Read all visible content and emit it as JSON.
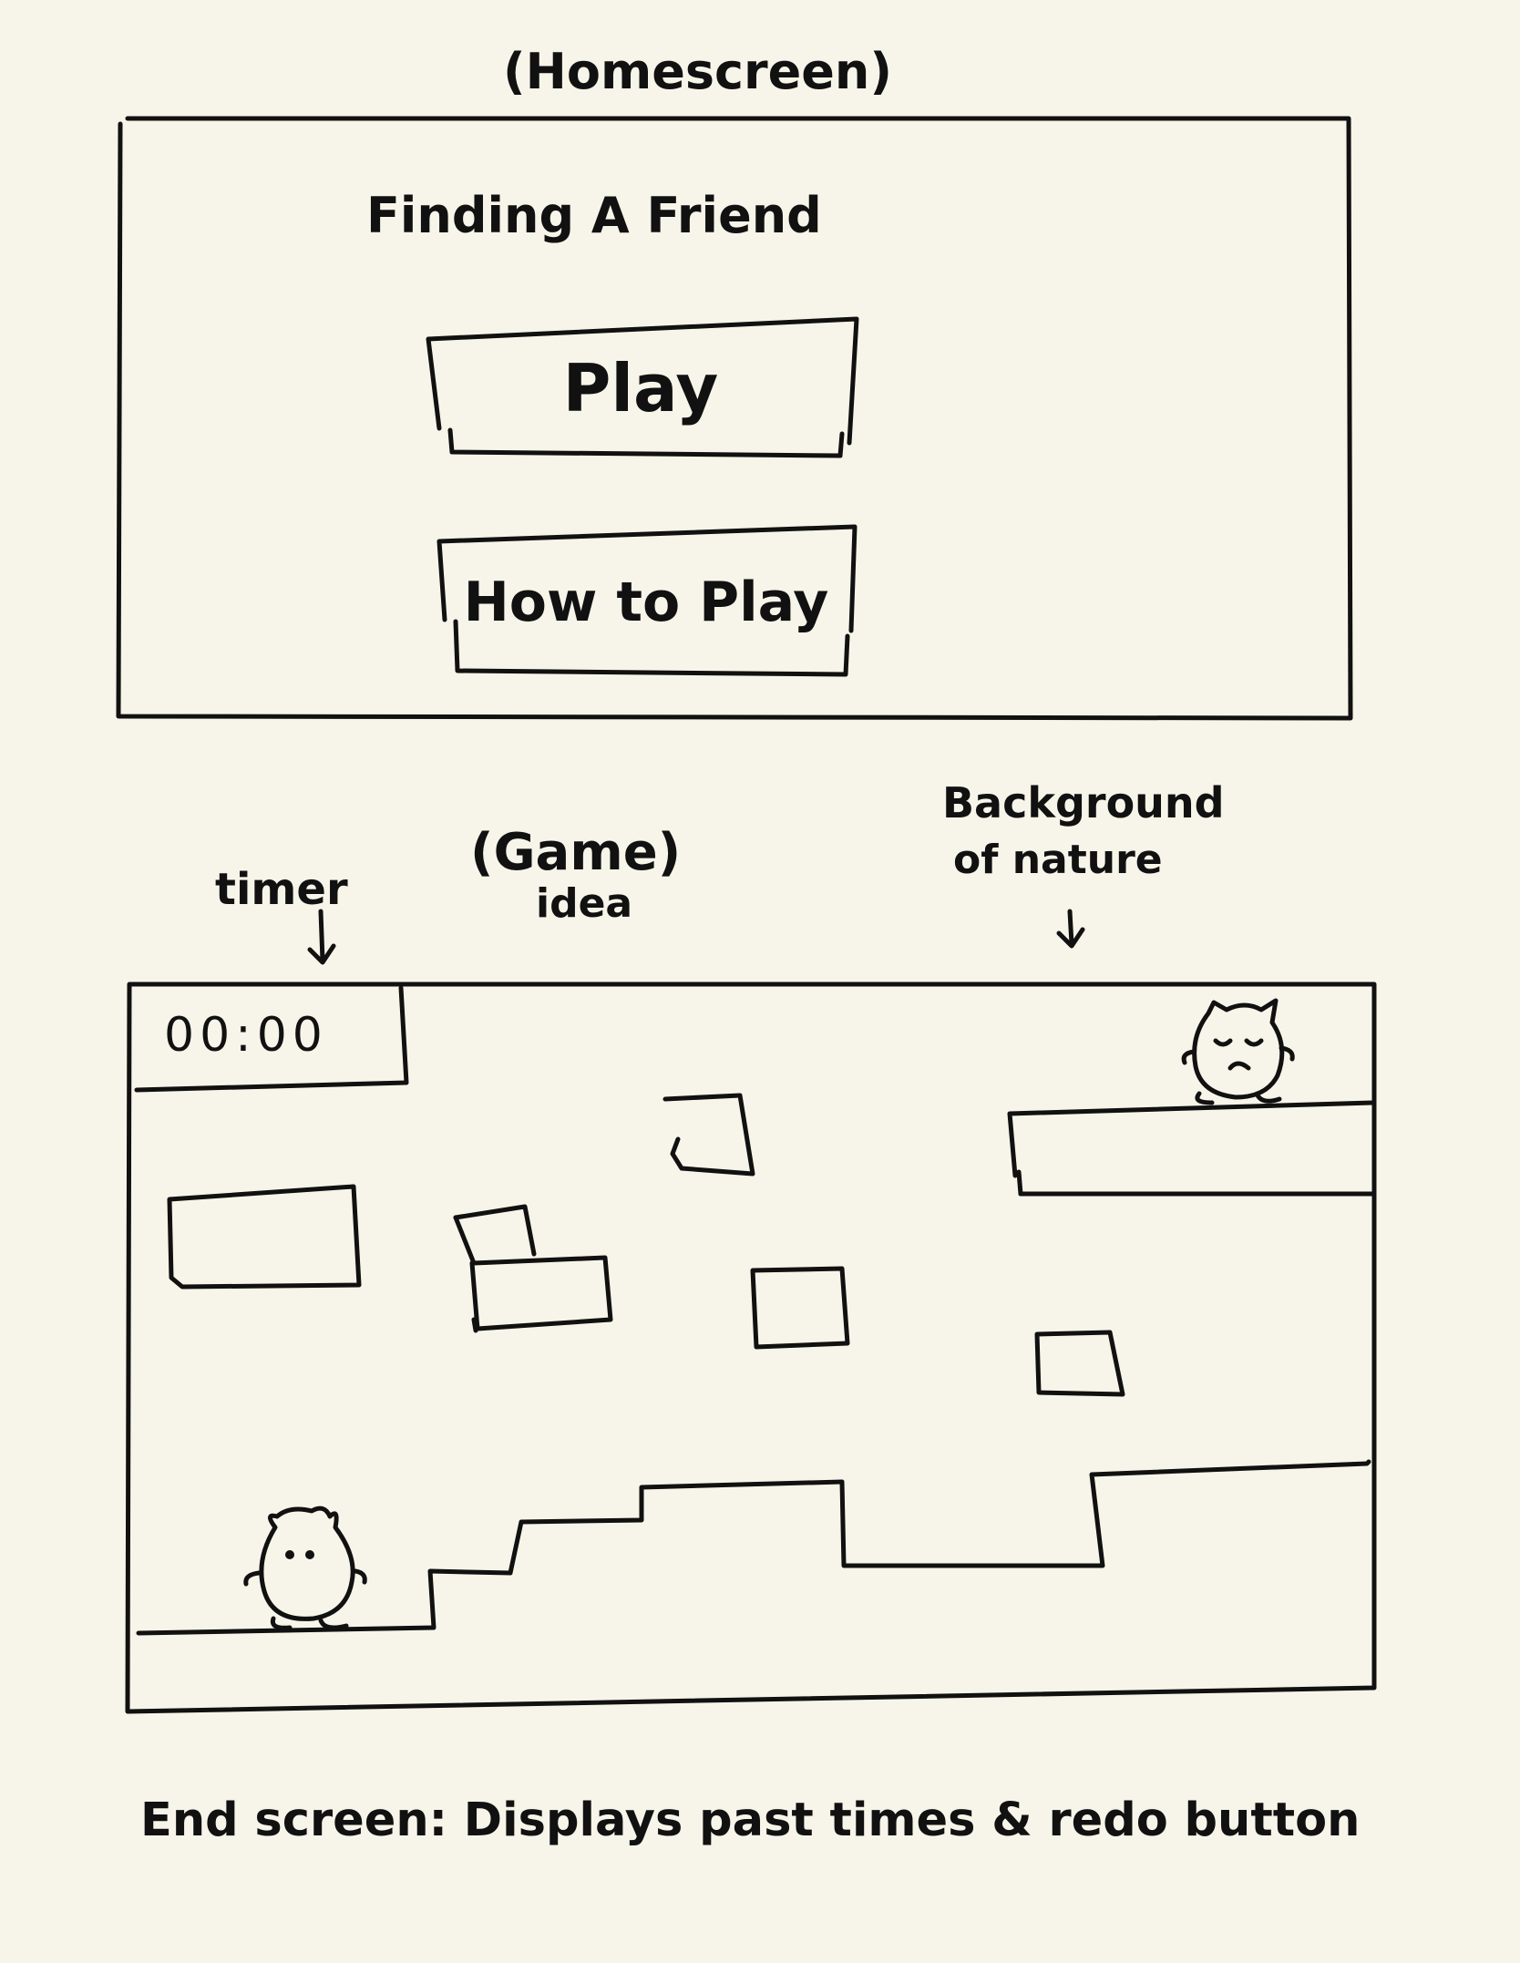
{
  "home": {
    "caption": "(Homescreen)",
    "title": "Finding A Friend",
    "play_label": "Play",
    "howto_label": "How to Play"
  },
  "game": {
    "caption": "(Game)",
    "caption_sub": "idea",
    "timer_note": "timer",
    "timer_value": "00:00",
    "background_note_line1": "Background",
    "background_note_line2": "of nature"
  },
  "footer": {
    "end_note": "End screen: Displays past times & redo button"
  },
  "icons": {
    "player": "creature-icon",
    "friend": "sleeping-creature-icon",
    "arrows": "arrow-down-icon"
  },
  "colors": {
    "paper": "#f7f5e9",
    "ink": "#111111"
  }
}
